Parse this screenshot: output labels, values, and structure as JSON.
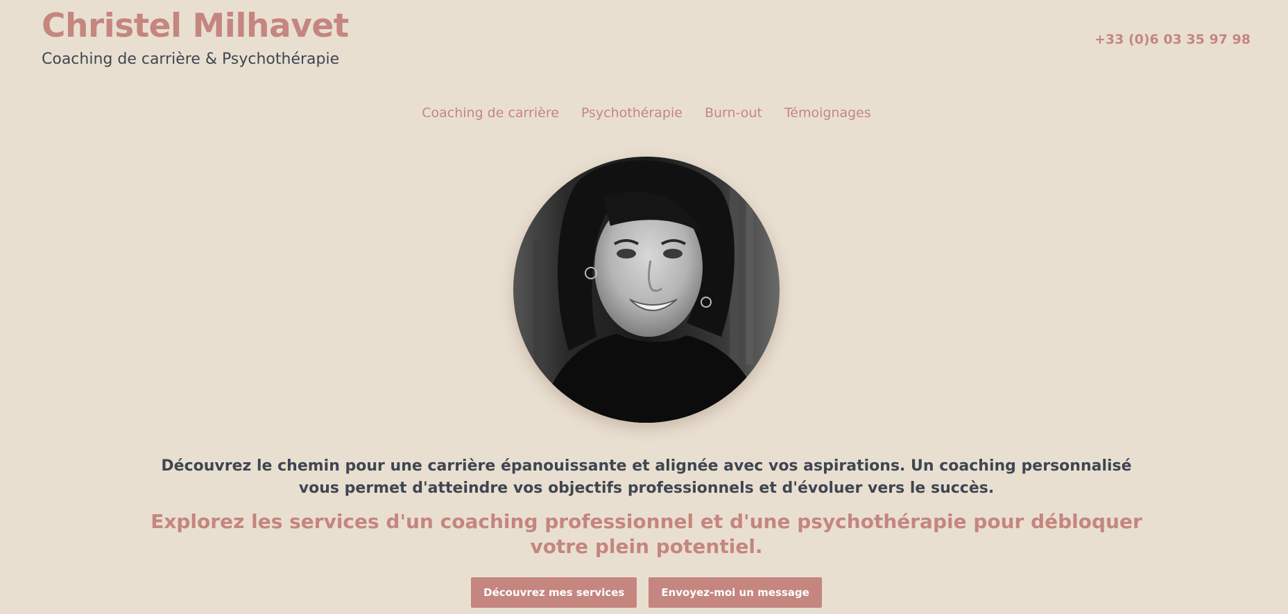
{
  "header": {
    "title": "Christel Milhavet",
    "subtitle": "Coaching de carrière & Psychothérapie",
    "phone": "+33 (0)6 03 35 97 98"
  },
  "nav": {
    "items": [
      {
        "label": "Coaching de carrière"
      },
      {
        "label": "Psychothérapie"
      },
      {
        "label": "Burn-out"
      },
      {
        "label": "Témoignages"
      }
    ]
  },
  "hero": {
    "intro": "Découvrez le chemin pour une carrière épanouissante et alignée avec vos aspirations. Un coaching personnalisé vous permet d'atteindre vos objectifs professionnels et d'évoluer vers le succès.",
    "tagline": "Explorez les services d'un coaching professionnel et d'une psychothérapie pour débloquer votre plein potentiel.",
    "cta_primary": "Découvrez mes services",
    "cta_secondary": "Envoyez-moi un message"
  },
  "colors": {
    "background": "#e9dfd1",
    "accent": "#c4867f",
    "text": "#3e4651",
    "button_text": "#ffffff"
  }
}
